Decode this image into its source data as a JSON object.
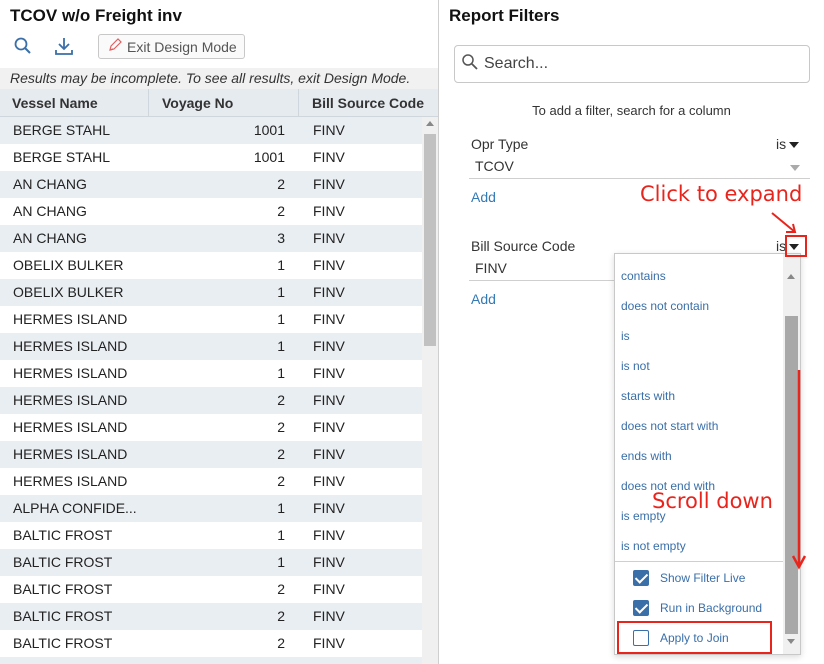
{
  "left": {
    "title": "TCOV w/o Freight inv",
    "toolbar": {
      "search_icon": "search-icon",
      "download_icon": "download-icon",
      "exit_design_label": "Exit Design Mode"
    },
    "notice": "Results may be incomplete. To see all results, exit Design Mode.",
    "columns": [
      "Vessel Name",
      "Voyage No",
      "Bill Source Code"
    ],
    "rows": [
      [
        "BERGE STAHL",
        "1001",
        "FINV"
      ],
      [
        "BERGE STAHL",
        "1001",
        "FINV"
      ],
      [
        "AN CHANG",
        "2",
        "FINV"
      ],
      [
        "AN CHANG",
        "2",
        "FINV"
      ],
      [
        "AN CHANG",
        "3",
        "FINV"
      ],
      [
        "OBELIX BULKER",
        "1",
        "FINV"
      ],
      [
        "OBELIX BULKER",
        "1",
        "FINV"
      ],
      [
        "HERMES ISLAND",
        "1",
        "FINV"
      ],
      [
        "HERMES ISLAND",
        "1",
        "FINV"
      ],
      [
        "HERMES ISLAND",
        "1",
        "FINV"
      ],
      [
        "HERMES ISLAND",
        "2",
        "FINV"
      ],
      [
        "HERMES ISLAND",
        "2",
        "FINV"
      ],
      [
        "HERMES ISLAND",
        "2",
        "FINV"
      ],
      [
        "HERMES ISLAND",
        "2",
        "FINV"
      ],
      [
        "ALPHA CONFIDE...",
        "1",
        "FINV"
      ],
      [
        "BALTIC FROST",
        "1",
        "FINV"
      ],
      [
        "BALTIC FROST",
        "1",
        "FINV"
      ],
      [
        "BALTIC FROST",
        "2",
        "FINV"
      ],
      [
        "BALTIC FROST",
        "2",
        "FINV"
      ],
      [
        "BALTIC FROST",
        "2",
        "FINV"
      ],
      [
        "",
        "",
        ""
      ]
    ]
  },
  "right": {
    "title": "Report Filters",
    "search_placeholder": "Search...",
    "hint": "To add a filter, search for a column",
    "filters": [
      {
        "label": "Opr Type",
        "operator": "is",
        "value": "TCOV",
        "add_label": "Add"
      },
      {
        "label": "Bill Source Code",
        "operator": "is",
        "value": "FINV",
        "add_label": "Add"
      }
    ],
    "dropdown": {
      "options": [
        "contains",
        "does not contain",
        "is",
        "is not",
        "starts with",
        "does not start with",
        "ends with",
        "does not end with",
        "is empty",
        "is not empty"
      ],
      "checks": [
        {
          "label": "Show Filter Live",
          "checked": true
        },
        {
          "label": "Run in Background",
          "checked": true
        },
        {
          "label": "Apply to Join",
          "checked": false
        }
      ]
    }
  },
  "annotations": {
    "expand": "Click to expand",
    "scroll": "Scroll down",
    "color": "#e8251d"
  }
}
